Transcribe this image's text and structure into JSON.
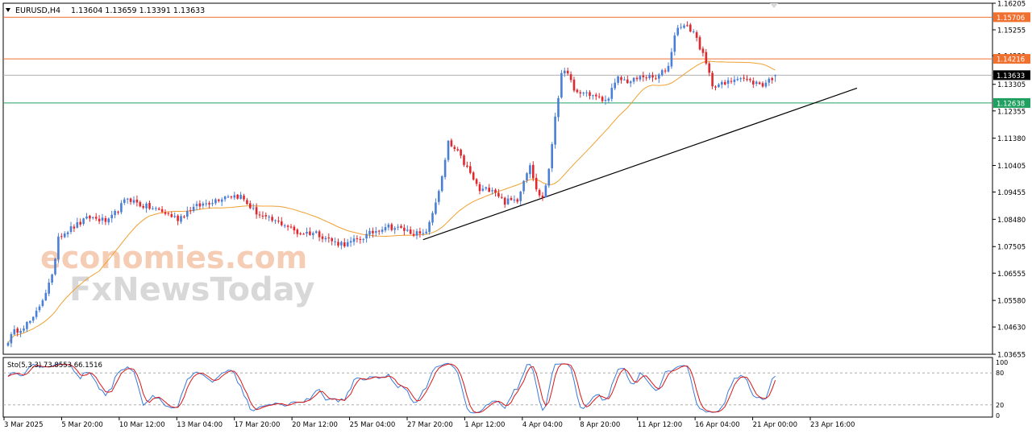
{
  "header": {
    "dropdown_icon": "triangle-down-icon",
    "symbol": "EURUSD,H4",
    "ohlc": "1.13604 1.13659 1.13391 1.13633"
  },
  "watermark": {
    "line1": "economies.com",
    "line2": "FxNewsToday"
  },
  "colors": {
    "bull": "#4a7fd6",
    "bear": "#e0282e",
    "ma": "#f0a030",
    "resistance": "#f07030",
    "support": "#20a060",
    "price_line": "#b0b0b0",
    "trend": "#000000",
    "sto_main": "#3a7ad8",
    "sto_signal": "#d81818"
  },
  "chart_data": [
    {
      "type": "candlestick",
      "symbol": "EURUSD",
      "timeframe": "H4",
      "ylim": [
        1.03655,
        1.16205
      ],
      "y_ticks": [
        "1.16205",
        "1.15255",
        "1.14330",
        "1.13305",
        "1.12355",
        "1.11380",
        "1.10405",
        "1.09455",
        "1.08480",
        "1.07505",
        "1.06555",
        "1.05580",
        "1.04630",
        "1.03655"
      ],
      "x_ticks": [
        "3 Mar 2025",
        "5 Mar 20:00",
        "10 Mar 12:00",
        "13 Mar 04:00",
        "17 Mar 20:00",
        "20 Mar 12:00",
        "25 Mar 04:00",
        "27 Mar 20:00",
        "1 Apr 12:00",
        "4 Apr 04:00",
        "8 Apr 20:00",
        "11 Apr 12:00",
        "16 Apr 04:00",
        "21 Apr 00:00",
        "23 Apr 16:00"
      ],
      "levels": [
        {
          "label": "1.15706",
          "value": 1.15706,
          "kind": "resistance"
        },
        {
          "label": "1.14216",
          "value": 1.14216,
          "kind": "resistance"
        },
        {
          "label": "1.13633",
          "value": 1.13633,
          "kind": "current"
        },
        {
          "label": "1.12638",
          "value": 1.12638,
          "kind": "support"
        }
      ],
      "trendline": [
        {
          "bar": 132,
          "price": 1.0775
        },
        {
          "bar": 270,
          "price": 1.1317
        }
      ],
      "waypoints": [
        [
          0,
          1.0415
        ],
        [
          2,
          1.0445
        ],
        [
          8,
          1.049
        ],
        [
          10,
          1.054
        ],
        [
          14,
          1.064
        ],
        [
          16,
          1.079
        ],
        [
          20,
          1.0815
        ],
        [
          26,
          1.0855
        ],
        [
          32,
          1.084
        ],
        [
          38,
          1.0925
        ],
        [
          42,
          1.09
        ],
        [
          48,
          1.088
        ],
        [
          54,
          1.085
        ],
        [
          58,
          1.0885
        ],
        [
          64,
          1.091
        ],
        [
          70,
          1.0935
        ],
        [
          74,
          1.093
        ],
        [
          78,
          1.088
        ],
        [
          82,
          1.085
        ],
        [
          88,
          1.083
        ],
        [
          92,
          1.08
        ],
        [
          98,
          1.08
        ],
        [
          104,
          1.0765
        ],
        [
          108,
          1.076
        ],
        [
          114,
          1.079
        ],
        [
          120,
          1.0825
        ],
        [
          126,
          1.081
        ],
        [
          132,
          1.079
        ],
        [
          134,
          1.083
        ],
        [
          138,
          1.0995
        ],
        [
          140,
          1.112
        ],
        [
          143,
          1.1085
        ],
        [
          146,
          1.103
        ],
        [
          150,
          1.095
        ],
        [
          154,
          1.096
        ],
        [
          158,
          1.091
        ],
        [
          162,
          1.092
        ],
        [
          164,
          1.099
        ],
        [
          166,
          1.105
        ],
        [
          168,
          1.095
        ],
        [
          170,
          1.0925
        ],
        [
          172,
          1.102
        ],
        [
          174,
          1.122
        ],
        [
          176,
          1.136
        ],
        [
          178,
          1.138
        ],
        [
          180,
          1.13
        ],
        [
          184,
          1.13
        ],
        [
          188,
          1.128
        ],
        [
          190,
          1.127
        ],
        [
          194,
          1.135
        ],
        [
          198,
          1.134
        ],
        [
          202,
          1.136
        ],
        [
          206,
          1.135
        ],
        [
          210,
          1.1395
        ],
        [
          212,
          1.151
        ],
        [
          214,
          1.1545
        ],
        [
          218,
          1.152
        ],
        [
          220,
          1.1465
        ],
        [
          222,
          1.14
        ],
        [
          224,
          1.133
        ],
        [
          228,
          1.133
        ],
        [
          232,
          1.136
        ],
        [
          236,
          1.134
        ],
        [
          240,
          1.133
        ],
        [
          244,
          1.1363
        ]
      ]
    },
    {
      "type": "line",
      "indicator": "stochastic",
      "label": "Sto(5,3,3) 73.8553 66.1516",
      "ylim": [
        0,
        100
      ],
      "levels": [
        20,
        80
      ],
      "y_ticks": [
        "100",
        "80",
        "20",
        "0"
      ],
      "series": [
        {
          "name": "main",
          "last": 73.8553
        },
        {
          "name": "signal",
          "last": 66.1516
        }
      ]
    }
  ]
}
